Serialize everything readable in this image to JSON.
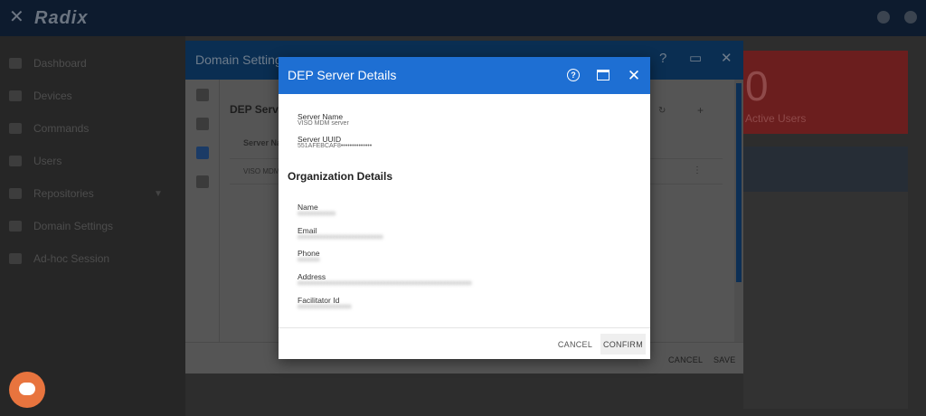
{
  "app": {
    "brand": "Radix"
  },
  "sidebar": {
    "items": [
      {
        "label": "Dashboard"
      },
      {
        "label": "Devices"
      },
      {
        "label": "Commands"
      },
      {
        "label": "Users"
      },
      {
        "label": "Repositories"
      },
      {
        "label": "Domain Settings"
      },
      {
        "label": "Ad-hoc Session"
      }
    ]
  },
  "stats": {
    "active_users_value": "0",
    "active_users_label": "Active Users"
  },
  "domain_settings": {
    "title": "Domain Settings",
    "inner_title": "DEP Serve",
    "column_server_name": "Server Na",
    "row_server_name": "VISO MDM",
    "cancel": "CANCEL",
    "save": "SAVE"
  },
  "dep_dialog": {
    "title": "DEP Server Details",
    "server_name_label": "Server Name",
    "server_name_value": "VISO MDM server",
    "server_uuid_label": "Server UUID",
    "server_uuid_value": "551AFEBCAF8••••••••••••••",
    "org_section_title": "Organization Details",
    "name_label": "Name",
    "email_label": "Email",
    "phone_label": "Phone",
    "address_label": "Address",
    "facilitator_label": "Facilitator Id",
    "cancel": "CANCEL",
    "confirm": "CONFIRM"
  },
  "colors": {
    "dialog_header": "#1e6fd3",
    "dimmed_header": "#0a2e52",
    "chat_button": "#e8743e",
    "stat_card": "#6b1e1e"
  },
  "icons": {
    "help": "help-circle-icon",
    "maximize": "maximize-icon",
    "close": "close-icon",
    "chat": "chat-icon",
    "refresh": "refresh-icon",
    "add": "add-icon",
    "more": "more-vertical-icon"
  }
}
